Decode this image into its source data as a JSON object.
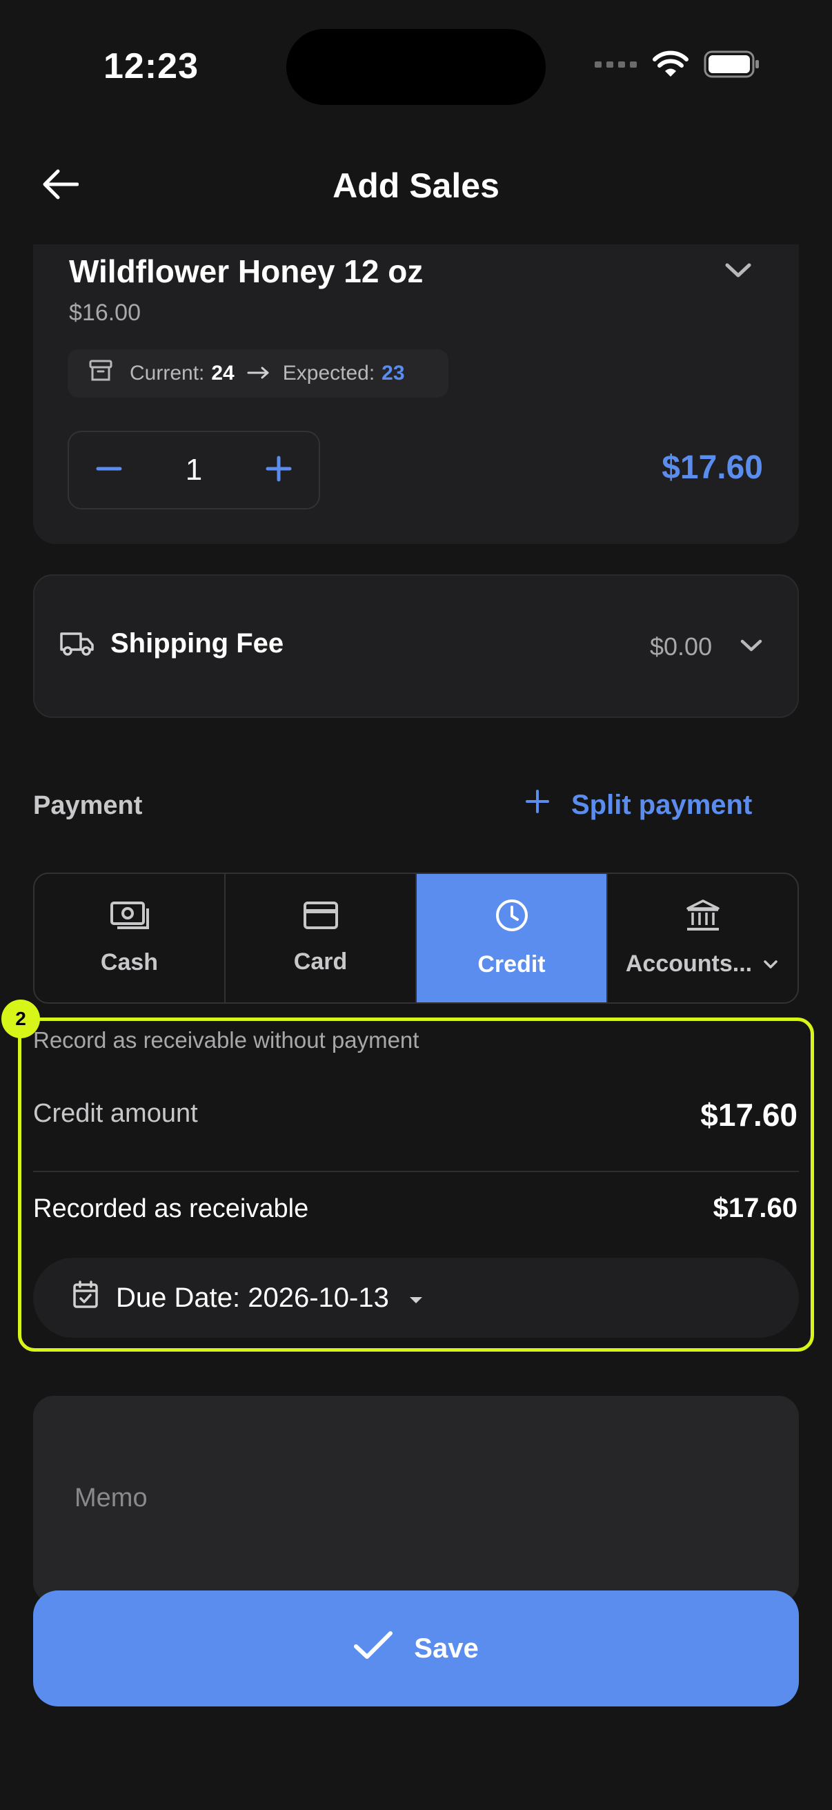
{
  "status_bar": {
    "time": "12:23"
  },
  "header": {
    "title": "Add Sales",
    "back_icon": "arrow-left-icon"
  },
  "product": {
    "name": "Wildflower Honey 12 oz",
    "price": "$16.00",
    "stock": {
      "current_label": "Current:",
      "current_value": "24",
      "expected_label": "Expected:",
      "expected_value": "23"
    },
    "quantity": "1",
    "line_total": "$17.60"
  },
  "shipping": {
    "label": "Shipping Fee",
    "value": "$0.00"
  },
  "payment": {
    "label": "Payment",
    "split_label": "Split payment",
    "methods": [
      {
        "label": "Cash",
        "icon": "cash-icon",
        "active": false
      },
      {
        "label": "Card",
        "icon": "card-icon",
        "active": false
      },
      {
        "label": "Credit",
        "icon": "clock-icon",
        "active": true
      },
      {
        "label": "Accounts...",
        "icon": "bank-icon",
        "active": false
      }
    ]
  },
  "credit_section": {
    "badge": "2",
    "note": "Record as receivable without payment",
    "amount_label": "Credit amount",
    "amount_value": "$17.60",
    "receivable_label": "Recorded as receivable",
    "receivable_value": "$17.60",
    "due_date": "Due Date: 2026-10-13"
  },
  "memo": {
    "placeholder": "Memo",
    "value": ""
  },
  "save": {
    "label": "Save"
  },
  "colors": {
    "accent": "#5b8def",
    "highlight": "#d7f518",
    "background": "#151516"
  }
}
